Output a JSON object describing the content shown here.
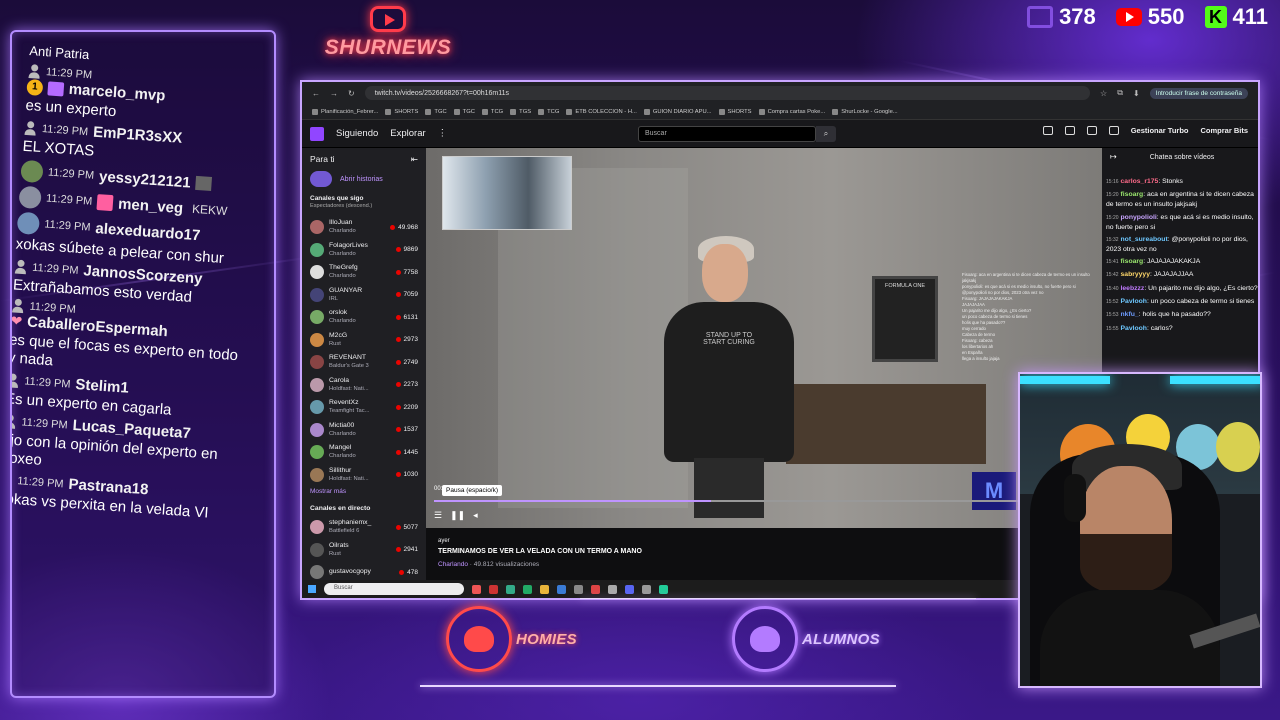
{
  "stream": {
    "logo_text": "SHURNEWS",
    "stats": [
      {
        "platform": "twitch",
        "icon": "twitch-icon",
        "value": "378"
      },
      {
        "platform": "youtube",
        "icon": "youtube-icon",
        "value": "550"
      },
      {
        "platform": "kick",
        "icon": "kick-icon",
        "value": "411"
      }
    ],
    "bottom_logos": {
      "homies": "HOMIES",
      "alumnos": "ALUMNOS"
    }
  },
  "overlay_chat": {
    "top_partial": "Anti Patria",
    "messages": [
      {
        "time": "11:29 PM",
        "user": "marcelo_mvp",
        "text": "es un experto"
      },
      {
        "time": "11:29 PM",
        "user": "EmP1R3sXX",
        "text": "EL XOTAS"
      },
      {
        "time": "11:29 PM",
        "user": "yessy212121",
        "text": ""
      },
      {
        "time": "11:29 PM",
        "user": "men_veg",
        "text": "",
        "emote": "KEKW"
      },
      {
        "time": "11:29 PM",
        "user": "alexeduardo17",
        "text": "xokas súbete a pelear con shur"
      },
      {
        "time": "11:29 PM",
        "user": "JannosScorzeny",
        "text": "Extrañabamos esto verdad"
      },
      {
        "time": "11:29 PM",
        "user": "CaballeroEspermah",
        "text": "es que el focas es experto en todo y nada"
      },
      {
        "time": "11:29 PM",
        "user": "Stelim1",
        "text": "Es un experto en cagarla"
      },
      {
        "time": "11:29 PM",
        "user": "Lucas_Paqueta7",
        "text": "ojo con la opinión del experto en boxeo"
      },
      {
        "time": "11:29 PM",
        "user": "Pastrana18",
        "text": "xokas vs perxita en la velada VI"
      }
    ]
  },
  "browser": {
    "url": "twitch.tv/videos/2526668267?t=00h16m11s",
    "password_btn": "Introducir frase de contraseña",
    "bookmarks": [
      "Planificación_Febrer...",
      "SHORTS",
      "TGC",
      "TGC",
      "TCG",
      "TGS",
      "TCG",
      "ETB COLECCION - H...",
      "GUION DIARIO APU...",
      "SHORTS",
      "Compra cartas Poke...",
      "ShurLocke - Google..."
    ]
  },
  "twitch": {
    "nav": {
      "following": "Siguiendo",
      "browse": "Explorar",
      "more": "⋮",
      "search_placeholder": "Buscar",
      "notif_count": "1",
      "turbo": "Gestionar Turbo",
      "bits": "Comprar Bits"
    },
    "sidebar": {
      "for_you": "Para ti",
      "history": "Abrir historias",
      "followed": "Canales que sigo",
      "followed_sort": "Espectadores (descend.)",
      "channels": [
        {
          "name": "IlloJuan",
          "game": "Charlando",
          "viewers": "49.968"
        },
        {
          "name": "FolagorLives",
          "game": "Charlando",
          "viewers": "9869"
        },
        {
          "name": "TheGrefg",
          "game": "Charlando",
          "viewers": "7758"
        },
        {
          "name": "GUANYAR",
          "game": "IRL",
          "viewers": "7059"
        },
        {
          "name": "orslok",
          "game": "Charlando",
          "viewers": "6131"
        },
        {
          "name": "M2cG",
          "game": "Rust",
          "viewers": "2973"
        },
        {
          "name": "REVENANT",
          "game": "Baldur's Gate 3",
          "viewers": "2749"
        },
        {
          "name": "Carola",
          "game": "Holdfast: Nati...",
          "viewers": "2273"
        },
        {
          "name": "ReventXz",
          "game": "Teamfight Tac...",
          "viewers": "2209"
        },
        {
          "name": "Mictia00",
          "game": "Charlando",
          "viewers": "1537"
        },
        {
          "name": "Mangel",
          "game": "Charlando",
          "viewers": "1445"
        },
        {
          "name": "Sillithur",
          "game": "Holdfast: Nati...",
          "viewers": "1030"
        }
      ],
      "show_more": "Mostrar más",
      "live_channels": "Canales en directo",
      "live": [
        {
          "name": "stephaniemx_",
          "game": "Battlefield 6",
          "viewers": "5077"
        },
        {
          "name": "Oilrats",
          "game": "Rust",
          "viewers": "2941"
        },
        {
          "name": "gustavocgopy",
          "game": "",
          "viewers": "478"
        }
      ]
    },
    "player": {
      "time": "00:",
      "tooltip": "Pausa (espacio/k)",
      "progress": 0.42,
      "poster_text": "FORMULA ONE",
      "shirt_text": "STAND UP TO START CURING",
      "brand_logo": "M",
      "cc": "CC"
    },
    "video": {
      "date": "ayer",
      "title": "TERMINAMOS DE VER LA VELADA CON UN TERMO A MANO",
      "category": "Charlando",
      "views": "49.812 visualizaciones"
    },
    "chat": {
      "header": "Chatea sobre vídeos",
      "lines": [
        {
          "t": "15:16",
          "user": "carlos_r175",
          "text": "Stonks"
        },
        {
          "t": "15:20",
          "user": "fisoarg",
          "text": "aca en argentina si te dicen cabeza de termo es un insulto jakjsakj"
        },
        {
          "t": "15:20",
          "user": "ponypolioli",
          "text": "es que acá si es medio insulto, no fuerte pero si"
        },
        {
          "t": "15:32",
          "user": "not_sureabout",
          "text": "@ponypolioli no por dios, 2023 otra vez no"
        },
        {
          "t": "15:41",
          "user": "fisoarg",
          "text": "JAJAJAJAKAKJA"
        },
        {
          "t": "15:42",
          "user": "sabryyyy",
          "text": "JAJAJAJJAA"
        },
        {
          "t": "15:40",
          "user": "leebzzz",
          "text": "Un pajarito me dijo algo, ¿Es cierto?"
        },
        {
          "t": "15:52",
          "user": "Pavlooh",
          "text": "un poco cabeza de termo si tienes"
        },
        {
          "t": "15:53",
          "user": "nkfu_",
          "text": "holis que ha pasado??"
        },
        {
          "t": "15:55",
          "user": "Pavlooh",
          "text": "carlos?"
        }
      ],
      "reflect_lines": [
        "Fisoarg: aca en argentina si te dicen cabeza de termo es un insulto jakjsakj",
        "ponypolioli: es que acá si es medio insulto, no fuerte pero si",
        "@ponypolioli no por dios, 2023 otra vez no",
        "Fisoarg: JAJAJAJAKAKJA",
        "JAJAJAJAA",
        "Un pajarito me dijo algo, ¿Es cierto?",
        "un poco cabeza de termo si tienes",
        "holis que ha pasado??",
        "muy cerrado",
        "Cabeza de termo",
        "Fisoarg: cabeza",
        "los libertarios ah",
        "en España",
        "llega a insulto jajaja"
      ]
    }
  },
  "taskbar": {
    "search": "Buscar"
  }
}
